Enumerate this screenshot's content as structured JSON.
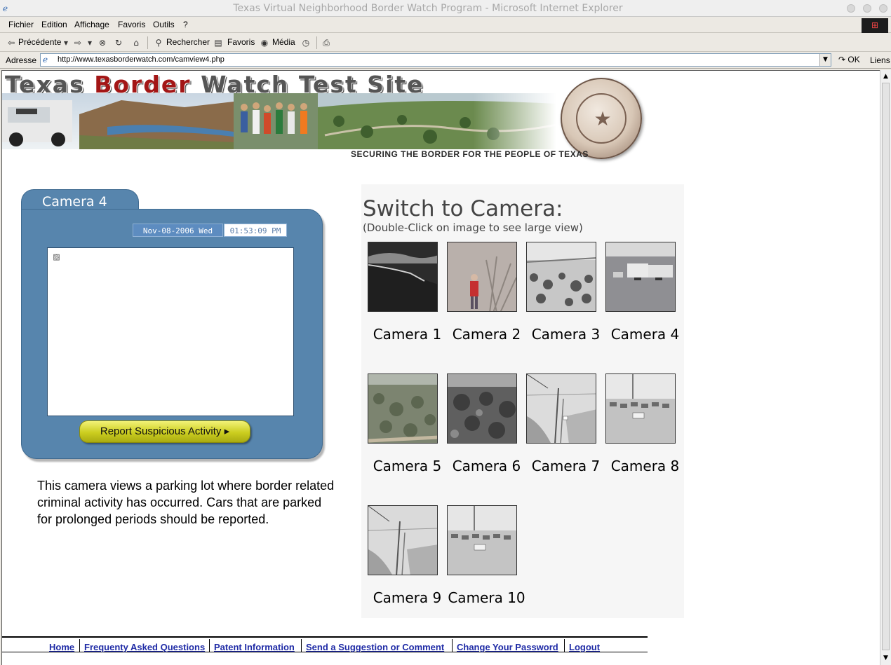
{
  "window": {
    "title": "Texas Virtual Neighborhood Border Watch Program - Microsoft Internet Explorer"
  },
  "menubar": {
    "items": [
      "Fichier",
      "Edition",
      "Affichage",
      "Favoris",
      "Outils",
      "?"
    ]
  },
  "toolbar": {
    "back_label": "Précédente",
    "search_label": "Rechercher",
    "favorites_label": "Favoris",
    "media_label": "Média"
  },
  "addressbar": {
    "label": "Adresse",
    "url": "http://www.texasborderwatch.com/camview4.php",
    "go_label": "OK",
    "links_label": "Liens"
  },
  "banner": {
    "title_part1": "Texas ",
    "title_part2": "Border",
    "title_part3": " Watch Test Site",
    "tagline": "SECURING THE BORDER FOR THE PEOPLE OF TEXAS"
  },
  "camera_view": {
    "tab_label": "Camera 4",
    "date": "Nov-08-2006  Wed",
    "time": "01:53:09 PM",
    "report_button": "Report Suspicious Activity",
    "description": "This camera views a parking lot where border related criminal activity has occurred. Cars that are parked for prolonged periods should be reported."
  },
  "switch_panel": {
    "heading": "Switch to Camera:",
    "subheading": "(Double-Click on image to see large view)",
    "cameras": [
      {
        "label": "Camera 1"
      },
      {
        "label": "Camera 2"
      },
      {
        "label": "Camera 3"
      },
      {
        "label": "Camera 4"
      },
      {
        "label": "Camera 5"
      },
      {
        "label": "Camera 6"
      },
      {
        "label": "Camera 7"
      },
      {
        "label": "Camera 8"
      },
      {
        "label": "Camera 9"
      },
      {
        "label": "Camera 10"
      }
    ]
  },
  "footer": {
    "links": [
      "Home",
      "Frequenty Asked Questions",
      "Patent Information",
      "Send a Suggestion or Comment",
      "Change Your Password",
      "Logout"
    ]
  },
  "colors": {
    "panel_blue": "#5785ad",
    "button_yellow": "#cbcd1f",
    "link_blue": "#1f2ba6",
    "title_red": "#a31616"
  }
}
